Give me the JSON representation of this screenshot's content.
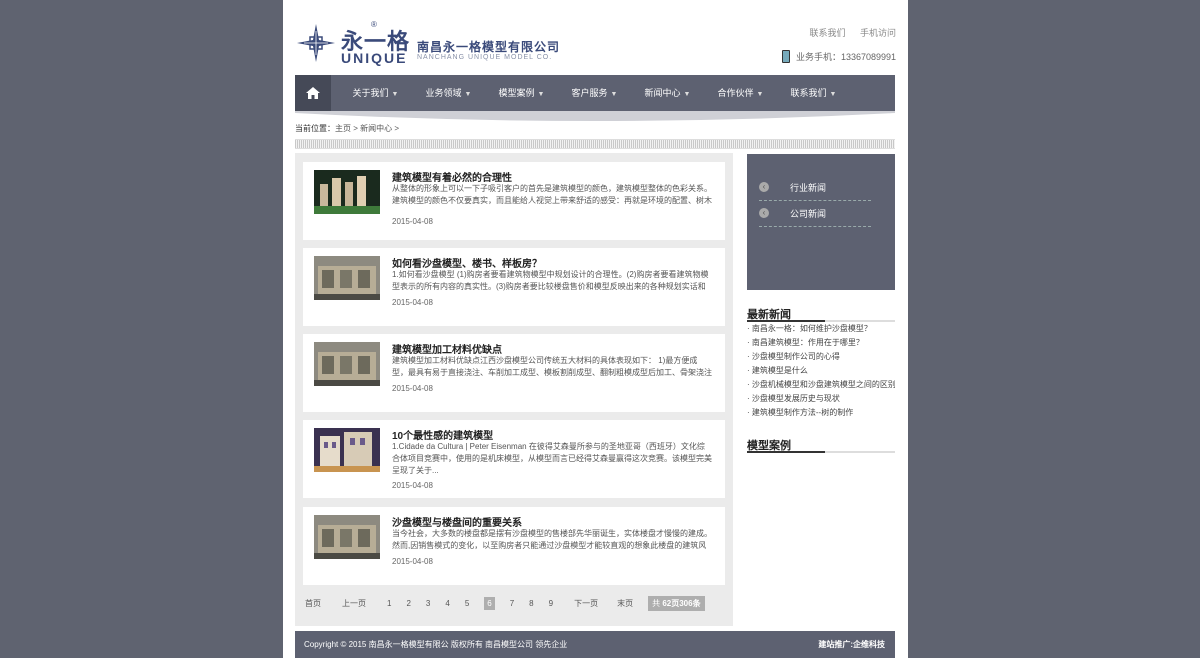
{
  "header": {
    "logo_cn": "永一格",
    "logo_en": "UNIQUE",
    "logo_reg": "®",
    "company_cn": "南昌永一格模型有限公司",
    "company_en": "NANCHANG UNIQUE MODEL CO.",
    "top_links": [
      "联系我们",
      "手机访问"
    ],
    "phone": "业务手机：13367089991"
  },
  "nav": {
    "home_icon": "home-icon",
    "items": [
      "关于我们",
      "业务领域",
      "模型案例",
      "客户服务",
      "新闻中心",
      "合作伙伴",
      "联系我们"
    ]
  },
  "breadcrumb": {
    "label": "当前位置：",
    "path": "主页 > 新闻中心 >"
  },
  "articles": [
    {
      "title": "建筑模型有着必然的合理性",
      "desc": "从整体的形象上可以一下子吸引客户的首先是建筑模型的颜色，建筑模型整体的色彩关系。建筑模型的颜色不仅要真实，而且能给人视觉上带来舒适的感受：再就是环境的配置、树木绿...",
      "date": "2015-04-08"
    },
    {
      "title": "如何看沙盘模型、楼书、样板房？",
      "desc": "1.如何看沙盘模型 (1)购房者要看建筑物模型中规划设计的合理性。(2)购房者要看建筑物模型表示的所有内容的真实性。(3)购房者要比较楼盘售价和模型反映出来的各种规划实话和建造成...",
      "date": "2015-04-08"
    },
    {
      "title": "建筑模型加工材料优缺点",
      "desc": "建筑模型加工材料优缺点江西沙盘模型公司传统五大材料的具体表现如下： 1)最方便成型，最具有易于直接浇注、车削加工成型、模板割削成型、翻制粗模成型后加工、骨架浇注成型加...",
      "date": "2015-04-08"
    },
    {
      "title": "10个最性感的建筑模型",
      "desc": "1.Cidade da Cultura | Peter Eisenman 在彼得艾森曼所参与的圣地亚哥（西班牙）文化综合体项目竞赛中，使用的是机床模型，从模型而言已经得艾森曼赢得这次竞赛。该模型完美呈现了关于...",
      "date": "2015-04-08"
    },
    {
      "title": "沙盘模型与楼盘间的重要关系",
      "desc": "当今社会，大多数的楼盘都是摆有沙盘模型的售楼部先华丽诞生，实体楼盘才慢慢的建成。然而,因销售模式的变化，以至购房者只能通过沙盘模型才能较直观的想象此楼盘的建筑风格、...",
      "date": "2015-04-08"
    }
  ],
  "pagination": {
    "first": "首页",
    "prev": "上一页",
    "pages": [
      "1",
      "2",
      "3",
      "4",
      "5",
      "6",
      "7",
      "8",
      "9"
    ],
    "current": "6",
    "next": "下一页",
    "last": "末页",
    "total_prefix": "共 ",
    "total_pages": "62页",
    "total_count": "306条"
  },
  "sidebar": {
    "categories": [
      "行业新闻",
      "公司新闻"
    ],
    "latest_title": "最新新闻",
    "latest": [
      "南昌永一格：如何维护沙盘模型？",
      "南昌建筑模型：作用在于哪里？",
      "沙盘模型制作公司的心得",
      "建筑模型是什么",
      "沙盘机械模型和沙盘建筑模型之间的区别",
      "沙盘模型发展历史与现状",
      "建筑模型制作方法--树的制作"
    ],
    "cases_title": "模型案例"
  },
  "footer": {
    "copyright": "Copyright © 2015 南昌永一格模型有限公 版权所有  南昌模型公司 领先企业",
    "credit": "建站推广:企维科技"
  },
  "colors": {
    "background": "#5f6370",
    "nav": "#5d6171",
    "brand": "#3a4a7a"
  }
}
